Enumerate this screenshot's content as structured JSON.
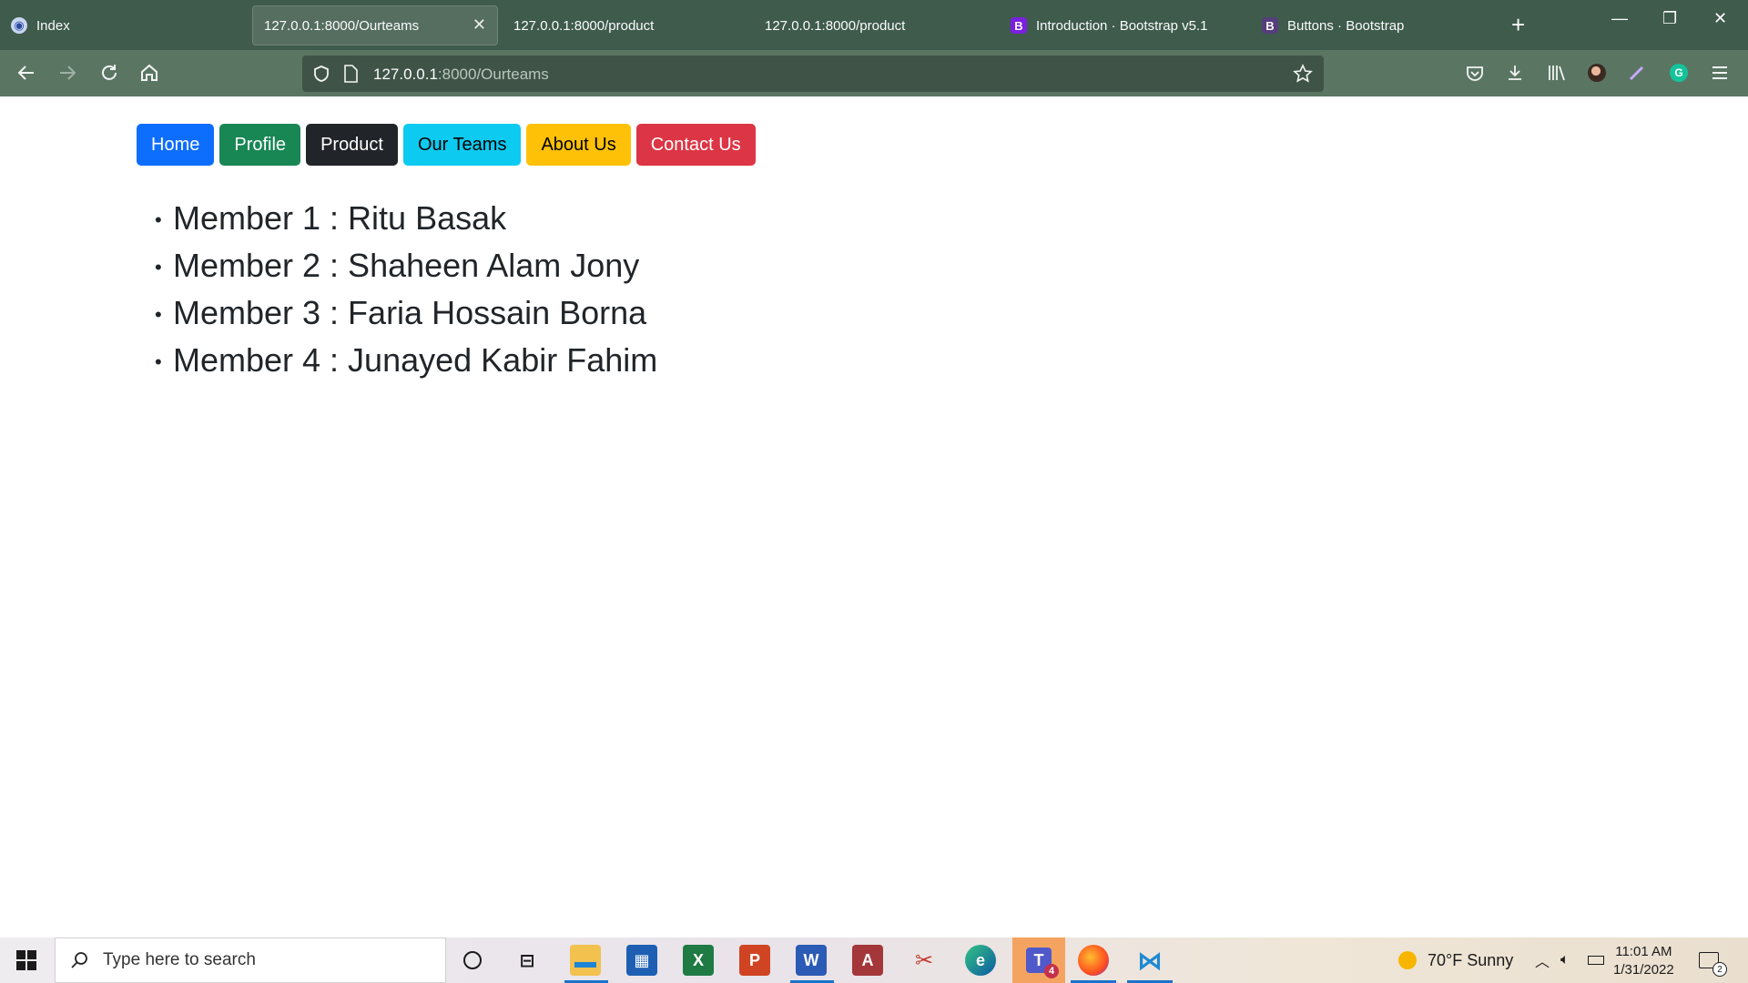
{
  "browser": {
    "tabs": [
      {
        "title": "Index",
        "favicon": "shield-favicon"
      },
      {
        "title": "127.0.0.1:8000/Ourteams",
        "active": true
      },
      {
        "title": "127.0.0.1:8000/product"
      },
      {
        "title": "127.0.0.1:8000/product"
      },
      {
        "title": "Introduction · Bootstrap v5.1",
        "favicon": "bootstrap-favicon"
      },
      {
        "title": "Buttons · Bootstrap",
        "favicon": "bootstrap-favicon"
      }
    ],
    "new_tab": "+",
    "url_host": "127.0.0.1",
    "url_path": ":8000/Ourteams",
    "window_controls": {
      "minimize": "—",
      "restore": "❐",
      "close": "✕"
    }
  },
  "page": {
    "nav_buttons": [
      {
        "label": "Home",
        "color": "#0d6efd",
        "text_color": "#ffffff"
      },
      {
        "label": "Profile",
        "color": "#198754",
        "text_color": "#ffffff"
      },
      {
        "label": "Product",
        "color": "#212529",
        "text_color": "#ffffff"
      },
      {
        "label": "Our Teams",
        "color": "#0dcaf0",
        "text_color": "#000000"
      },
      {
        "label": "About Us",
        "color": "#ffc107",
        "text_color": "#000000"
      },
      {
        "label": "Contact Us",
        "color": "#dc3545",
        "text_color": "#ffffff"
      }
    ],
    "members": [
      "Member 1 : Ritu Basak",
      "Member 2 : Shaheen Alam Jony",
      "Member 3 : Faria Hossain Borna",
      "Member 4 : Junayed Kabir Fahim"
    ]
  },
  "taskbar": {
    "search_placeholder": "Type here to search",
    "apps": [
      "cortana-icon",
      "task-view-icon",
      "file-explorer-icon",
      "store-icon",
      "excel-icon",
      "powerpoint-icon",
      "word-icon",
      "access-icon",
      "snip-icon",
      "edge-icon",
      "teams-icon",
      "firefox-icon",
      "vscode-icon"
    ],
    "teams_badge": "4",
    "weather": "70°F  Sunny",
    "time": "11:01 AM",
    "date": "1/31/2022",
    "notification_count": "2"
  }
}
